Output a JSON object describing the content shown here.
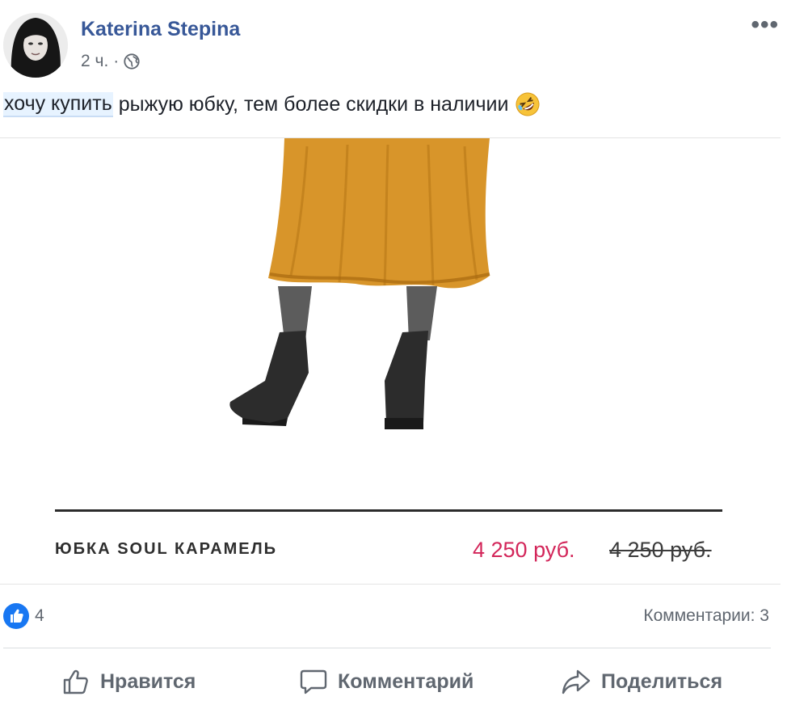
{
  "post": {
    "author": "Katerina Stepina",
    "time": "2 ч.",
    "separator": "·",
    "audience_icon": "globe-icon",
    "more_label": "•••",
    "text_highlight": "хочу купить",
    "text_rest": " рыжую юбку, тем более скидки в наличии",
    "emoji": "rolling-on-floor-laughing-emoji"
  },
  "media": {
    "product_name": "ЮБКА SOUL КАРАМЕЛЬ",
    "price_new": "4 250 руб.",
    "price_old": "4 250 руб.",
    "skirt_color": "#d8952a",
    "price_color": "#d3265a"
  },
  "reactions": {
    "likes": "4",
    "comments": "Комментарии: 3"
  },
  "actions": {
    "like": "Нравится",
    "comment": "Комментарий",
    "share": "Поделиться"
  },
  "colors": {
    "link": "#385898",
    "secondary_text": "#606770",
    "like_blue": "#1877f2"
  }
}
